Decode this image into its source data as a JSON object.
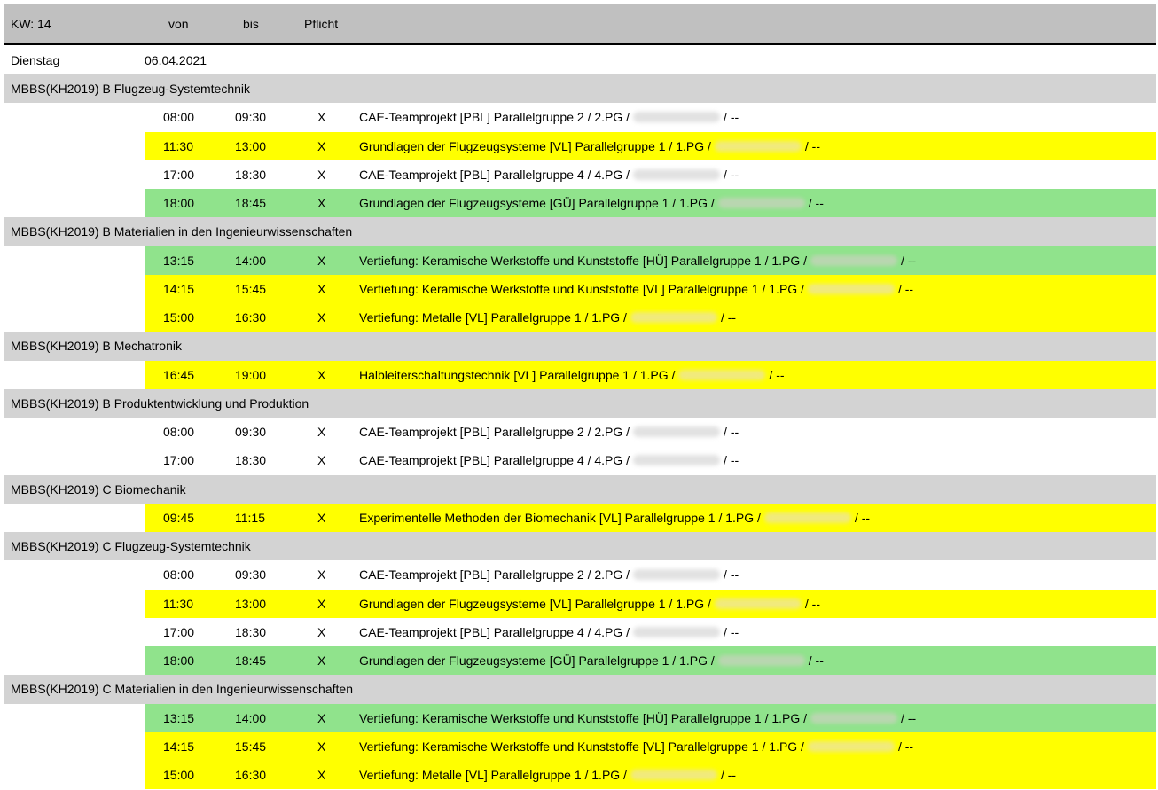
{
  "header": {
    "week": "KW: 14",
    "from": "von",
    "to": "bis",
    "required": "Pflicht"
  },
  "day": {
    "name": "Dienstag",
    "date": "06.04.2021"
  },
  "groups": [
    {
      "title": "MBBS(KH2019) B Flugzeug-Systemtechnik",
      "entries": [
        {
          "from": "08:00",
          "to": "09:30",
          "required": "X",
          "course": "CAE-Teamprojekt [PBL] Parallelgruppe 2 / 2.PG /",
          "suffix": "/ --",
          "color": "white"
        },
        {
          "from": "11:30",
          "to": "13:00",
          "required": "X",
          "course": "Grundlagen der Flugzeugsysteme [VL] Parallelgruppe 1 / 1.PG /",
          "suffix": "/ --",
          "color": "yellow"
        },
        {
          "from": "17:00",
          "to": "18:30",
          "required": "X",
          "course": "CAE-Teamprojekt [PBL] Parallelgruppe 4 / 4.PG /",
          "suffix": "/ --",
          "color": "white"
        },
        {
          "from": "18:00",
          "to": "18:45",
          "required": "X",
          "course": "Grundlagen der Flugzeugsysteme [GÜ] Parallelgruppe 1 / 1.PG /",
          "suffix": "/ --",
          "color": "green"
        }
      ]
    },
    {
      "title": "MBBS(KH2019) B Materialien in den Ingenieurwissenschaften",
      "entries": [
        {
          "from": "13:15",
          "to": "14:00",
          "required": "X",
          "course": "Vertiefung: Keramische Werkstoffe und Kunststoffe [HÜ] Parallelgruppe 1 / 1.PG /",
          "suffix": "/ --",
          "color": "green"
        },
        {
          "from": "14:15",
          "to": "15:45",
          "required": "X",
          "course": "Vertiefung: Keramische Werkstoffe und Kunststoffe [VL] Parallelgruppe 1 / 1.PG /",
          "suffix": "/ --",
          "color": "yellow"
        },
        {
          "from": "15:00",
          "to": "16:30",
          "required": "X",
          "course": "Vertiefung: Metalle [VL] Parallelgruppe 1 / 1.PG /",
          "suffix": "/ --",
          "color": "yellow"
        }
      ]
    },
    {
      "title": "MBBS(KH2019) B Mechatronik",
      "entries": [
        {
          "from": "16:45",
          "to": "19:00",
          "required": "X",
          "course": "Halbleiterschaltungstechnik [VL] Parallelgruppe 1 / 1.PG /",
          "suffix": "/ --",
          "color": "yellow"
        }
      ]
    },
    {
      "title": "MBBS(KH2019) B Produktentwicklung und Produktion",
      "entries": [
        {
          "from": "08:00",
          "to": "09:30",
          "required": "X",
          "course": "CAE-Teamprojekt [PBL] Parallelgruppe 2 / 2.PG /",
          "suffix": "/ --",
          "color": "white"
        },
        {
          "from": "17:00",
          "to": "18:30",
          "required": "X",
          "course": "CAE-Teamprojekt [PBL] Parallelgruppe 4 / 4.PG /",
          "suffix": "/ --",
          "color": "white"
        }
      ]
    },
    {
      "title": "MBBS(KH2019) C Biomechanik",
      "entries": [
        {
          "from": "09:45",
          "to": "11:15",
          "required": "X",
          "course": "Experimentelle Methoden der Biomechanik [VL] Parallelgruppe 1 / 1.PG /",
          "suffix": "/ --",
          "color": "yellow"
        }
      ]
    },
    {
      "title": "MBBS(KH2019) C Flugzeug-Systemtechnik",
      "entries": [
        {
          "from": "08:00",
          "to": "09:30",
          "required": "X",
          "course": "CAE-Teamprojekt [PBL] Parallelgruppe 2 / 2.PG /",
          "suffix": "/ --",
          "color": "white"
        },
        {
          "from": "11:30",
          "to": "13:00",
          "required": "X",
          "course": "Grundlagen der Flugzeugsysteme [VL] Parallelgruppe 1 / 1.PG /",
          "suffix": "/ --",
          "color": "yellow"
        },
        {
          "from": "17:00",
          "to": "18:30",
          "required": "X",
          "course": "CAE-Teamprojekt [PBL] Parallelgruppe 4 / 4.PG /",
          "suffix": "/ --",
          "color": "white"
        },
        {
          "from": "18:00",
          "to": "18:45",
          "required": "X",
          "course": "Grundlagen der Flugzeugsysteme [GÜ] Parallelgruppe 1 / 1.PG /",
          "suffix": "/ --",
          "color": "green"
        }
      ]
    },
    {
      "title": "MBBS(KH2019) C Materialien in den Ingenieurwissenschaften",
      "entries": [
        {
          "from": "13:15",
          "to": "14:00",
          "required": "X",
          "course": "Vertiefung: Keramische Werkstoffe und Kunststoffe [HÜ] Parallelgruppe 1 / 1.PG /",
          "suffix": "/ --",
          "color": "green"
        },
        {
          "from": "14:15",
          "to": "15:45",
          "required": "X",
          "course": "Vertiefung: Keramische Werkstoffe und Kunststoffe [VL] Parallelgruppe 1 / 1.PG /",
          "suffix": "/ --",
          "color": "yellow"
        },
        {
          "from": "15:00",
          "to": "16:30",
          "required": "X",
          "course": "Vertiefung: Metalle [VL] Parallelgruppe 1 / 1.PG /",
          "suffix": "/ --",
          "color": "yellow"
        }
      ]
    }
  ]
}
